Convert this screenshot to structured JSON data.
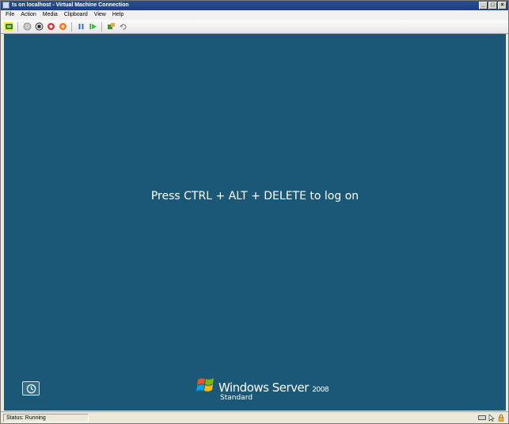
{
  "window": {
    "title": "ts on localhost - Virtual Machine Connection",
    "controls": {
      "minimize": "_",
      "maximize": "□",
      "close": "×"
    }
  },
  "menu": [
    "File",
    "Action",
    "Media",
    "Clipboard",
    "View",
    "Help"
  ],
  "toolbar": {
    "buttons": [
      {
        "icon": "ctrl-alt-del-icon",
        "highlighted": true
      },
      {
        "icon": "start-icon"
      },
      {
        "icon": "turn-off-icon"
      },
      {
        "icon": "shut-down-icon"
      },
      {
        "icon": "save-state-icon"
      },
      {
        "icon": "pause-icon"
      },
      {
        "icon": "resume-icon"
      },
      {
        "icon": "snapshot-icon"
      },
      {
        "icon": "revert-icon"
      }
    ]
  },
  "screen": {
    "message": "Press CTRL + ALT + DELETE to log on",
    "brand": {
      "product": "Windows Server",
      "version": "2008",
      "edition": "Standard"
    },
    "background": "#1b5877"
  },
  "status": {
    "text": "Status: Running"
  }
}
